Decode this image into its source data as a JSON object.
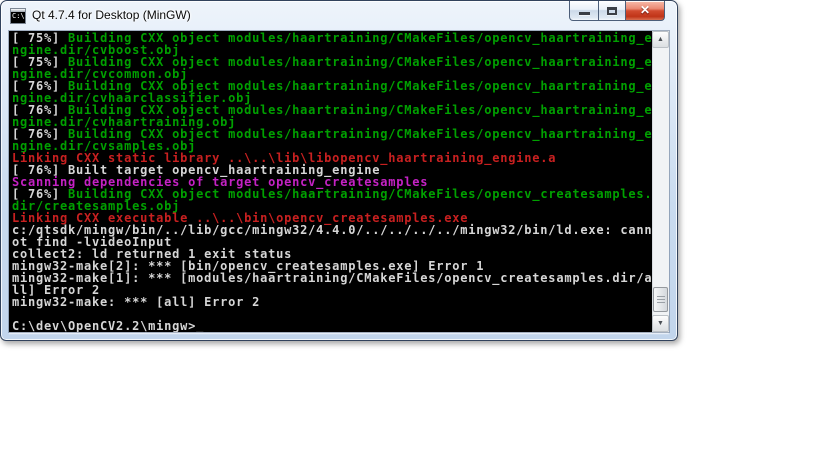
{
  "window": {
    "title": "Qt 4.7.4 for Desktop (MinGW)"
  },
  "icons": {
    "console_icon_text": "C:\\",
    "close": "✕",
    "scroll_up": "▲",
    "scroll_down": "▼"
  },
  "palette": {
    "default": "#d6d6d6",
    "green": "#00a000",
    "red": "#c82020",
    "magenta": "#c422c4"
  },
  "console": {
    "lines": [
      [
        {
          "text": "[ 75%] ",
          "color": "default"
        },
        {
          "text": "Building CXX object modules/haartraining/CMakeFiles/opencv_haartraining_e",
          "color": "green"
        }
      ],
      [
        {
          "text": "ngine.dir/cvboost.obj",
          "color": "green"
        }
      ],
      [
        {
          "text": "[ 75%] ",
          "color": "default"
        },
        {
          "text": "Building CXX object modules/haartraining/CMakeFiles/opencv_haartraining_e",
          "color": "green"
        }
      ],
      [
        {
          "text": "ngine.dir/cvcommon.obj",
          "color": "green"
        }
      ],
      [
        {
          "text": "[ 76%] ",
          "color": "default"
        },
        {
          "text": "Building CXX object modules/haartraining/CMakeFiles/opencv_haartraining_e",
          "color": "green"
        }
      ],
      [
        {
          "text": "ngine.dir/cvhaarclassifier.obj",
          "color": "green"
        }
      ],
      [
        {
          "text": "[ 76%] ",
          "color": "default"
        },
        {
          "text": "Building CXX object modules/haartraining/CMakeFiles/opencv_haartraining_e",
          "color": "green"
        }
      ],
      [
        {
          "text": "ngine.dir/cvhaartraining.obj",
          "color": "green"
        }
      ],
      [
        {
          "text": "[ 76%] ",
          "color": "default"
        },
        {
          "text": "Building CXX object modules/haartraining/CMakeFiles/opencv_haartraining_e",
          "color": "green"
        }
      ],
      [
        {
          "text": "ngine.dir/cvsamples.obj",
          "color": "green"
        }
      ],
      [
        {
          "text": "Linking CXX static library ..\\..\\lib\\libopencv_haartraining_engine.a",
          "color": "red"
        }
      ],
      [
        {
          "text": "[ 76%] Built target opencv_haartraining_engine",
          "color": "default"
        }
      ],
      [
        {
          "text": "Scanning dependencies of target opencv_createsamples",
          "color": "magenta"
        }
      ],
      [
        {
          "text": "[ 76%] ",
          "color": "default"
        },
        {
          "text": "Building CXX object modules/haartraining/CMakeFiles/opencv_createsamples.",
          "color": "green"
        }
      ],
      [
        {
          "text": "dir/createsamples.obj",
          "color": "green"
        }
      ],
      [
        {
          "text": "Linking CXX executable ..\\..\\bin\\opencv_createsamples.exe",
          "color": "red"
        }
      ],
      [
        {
          "text": "c:/qtsdk/mingw/bin/../lib/gcc/mingw32/4.4.0/../../../../mingw32/bin/ld.exe: cann",
          "color": "default"
        }
      ],
      [
        {
          "text": "ot find -lvideoInput",
          "color": "default"
        }
      ],
      [
        {
          "text": "collect2: ld returned 1 exit status",
          "color": "default"
        }
      ],
      [
        {
          "text": "mingw32-make[2]: *** [bin/opencv_createsamples.exe] Error 1",
          "color": "default"
        }
      ],
      [
        {
          "text": "mingw32-make[1]: *** [modules/haartraining/CMakeFiles/opencv_createsamples.dir/a",
          "color": "default"
        }
      ],
      [
        {
          "text": "ll] Error 2",
          "color": "default"
        }
      ],
      [
        {
          "text": "mingw32-make: *** [all] Error 2",
          "color": "default"
        }
      ],
      [
        {
          "text": "",
          "color": "default"
        }
      ],
      [
        {
          "text": "C:\\dev\\OpenCV2.2\\mingw>",
          "color": "default"
        },
        {
          "text": "_",
          "color": "default",
          "cursor": true
        }
      ]
    ]
  }
}
